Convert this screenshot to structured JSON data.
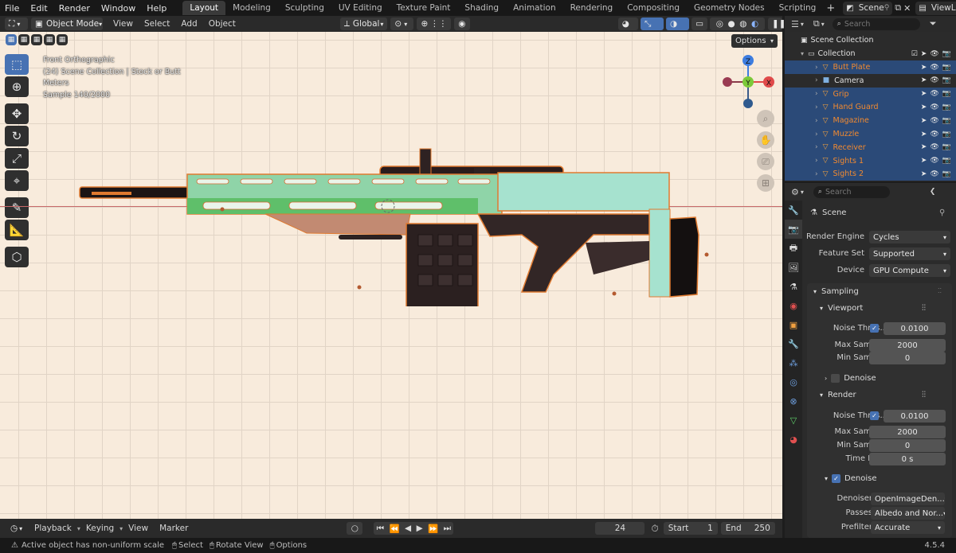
{
  "menu": [
    "File",
    "Edit",
    "Render",
    "Window",
    "Help"
  ],
  "workspaces": [
    "Layout",
    "Modeling",
    "Sculpting",
    "UV Editing",
    "Texture Paint",
    "Shading",
    "Animation",
    "Rendering",
    "Compositing",
    "Geometry Nodes",
    "Scripting"
  ],
  "active_workspace": "Layout",
  "scene_name": "Scene",
  "view_layer": "ViewLayer",
  "viewport_header": {
    "mode": "Object Mode",
    "menus": [
      "View",
      "Select",
      "Add",
      "Object"
    ],
    "orientation": "Global",
    "options": "Options"
  },
  "overlay": {
    "line1": "Front Orthographic",
    "line2": "(24) Scene Collection | Stock or Butt",
    "line3": "Meters",
    "line4": "Sample 140/2000"
  },
  "gizmo": {
    "z": "Z",
    "y": "Y",
    "x": "X"
  },
  "outliner": {
    "search_placeholder": "Search",
    "root": "Scene Collection",
    "collection": "Collection",
    "items": [
      {
        "name": "Butt Plate",
        "selected": true
      },
      {
        "name": "Camera",
        "selected": false
      },
      {
        "name": "Grip",
        "selected": true
      },
      {
        "name": "Hand Guard",
        "selected": true
      },
      {
        "name": "Magazine",
        "selected": true
      },
      {
        "name": "Muzzle",
        "selected": true
      },
      {
        "name": "Receiver",
        "selected": true
      },
      {
        "name": "Sights 1",
        "selected": true
      },
      {
        "name": "Sights 2",
        "selected": true
      }
    ]
  },
  "properties": {
    "search_placeholder": "Search",
    "context": "Scene",
    "render_engine_label": "Render Engine",
    "render_engine": "Cycles",
    "feature_set_label": "Feature Set",
    "feature_set": "Supported",
    "device_label": "Device",
    "device": "GPU Compute",
    "sampling": "Sampling",
    "viewport": "Viewport",
    "noise_label": "Noise Thres...",
    "vp_noise": "0.0100",
    "max_samples_label": "Max Samples",
    "vp_max": "2000",
    "min_samples_label": "Min Samples",
    "vp_min": "0",
    "denoise": "Denoise",
    "render": "Render",
    "r_noise": "0.0100",
    "r_max": "2000",
    "r_min": "0",
    "time_limit_label": "Time Limit",
    "time_limit": "0 s",
    "denoiser_label": "Denoiser",
    "denoiser": "OpenImageDen...",
    "passes_label": "Passes",
    "passes": "Albedo and Nor...",
    "prefilter_label": "Prefilter",
    "prefilter": "Accurate"
  },
  "timeline": {
    "menus": [
      "Playback",
      "Keying",
      "View",
      "Marker"
    ],
    "current_frame": "24",
    "start_label": "Start",
    "start": "1",
    "end_label": "End",
    "end": "250"
  },
  "status": {
    "warning": "Active object has non-uniform scale",
    "select": "Select",
    "rotate": "Rotate View",
    "options": "Options",
    "version": "4.5.4"
  }
}
